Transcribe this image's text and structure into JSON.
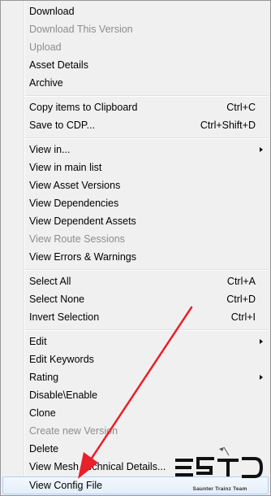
{
  "menu": {
    "items": [
      {
        "label": "Download",
        "shortcut": "",
        "submenu": false,
        "disabled": false
      },
      {
        "label": "Download This Version",
        "shortcut": "",
        "submenu": false,
        "disabled": true
      },
      {
        "label": "Upload",
        "shortcut": "",
        "submenu": false,
        "disabled": true
      },
      {
        "label": "Asset Details",
        "shortcut": "",
        "submenu": false,
        "disabled": false
      },
      {
        "label": "Archive",
        "shortcut": "",
        "submenu": false,
        "disabled": false
      },
      {
        "separator": true
      },
      {
        "label": "Copy items to Clipboard",
        "shortcut": "Ctrl+C",
        "submenu": false,
        "disabled": false
      },
      {
        "label": "Save to CDP...",
        "shortcut": "Ctrl+Shift+D",
        "submenu": false,
        "disabled": false
      },
      {
        "separator": true
      },
      {
        "label": "View in...",
        "shortcut": "",
        "submenu": true,
        "disabled": false
      },
      {
        "label": "View in main list",
        "shortcut": "",
        "submenu": false,
        "disabled": false
      },
      {
        "label": "View Asset Versions",
        "shortcut": "",
        "submenu": false,
        "disabled": false
      },
      {
        "label": "View Dependencies",
        "shortcut": "",
        "submenu": false,
        "disabled": false
      },
      {
        "label": "View Dependent Assets",
        "shortcut": "",
        "submenu": false,
        "disabled": false
      },
      {
        "label": "View Route Sessions",
        "shortcut": "",
        "submenu": false,
        "disabled": true
      },
      {
        "label": "View Errors & Warnings",
        "shortcut": "",
        "submenu": false,
        "disabled": false
      },
      {
        "separator": true
      },
      {
        "label": "Select All",
        "shortcut": "Ctrl+A",
        "submenu": false,
        "disabled": false
      },
      {
        "label": "Select None",
        "shortcut": "Ctrl+D",
        "submenu": false,
        "disabled": false
      },
      {
        "label": "Invert Selection",
        "shortcut": "Ctrl+I",
        "submenu": false,
        "disabled": false
      },
      {
        "separator": true
      },
      {
        "label": "Edit",
        "shortcut": "",
        "submenu": true,
        "disabled": false
      },
      {
        "label": "Edit Keywords",
        "shortcut": "",
        "submenu": false,
        "disabled": false
      },
      {
        "label": "Rating",
        "shortcut": "",
        "submenu": true,
        "disabled": false
      },
      {
        "label": "Disable\\Enable",
        "shortcut": "",
        "submenu": false,
        "disabled": false
      },
      {
        "label": "Clone",
        "shortcut": "",
        "submenu": false,
        "disabled": false
      },
      {
        "label": "Create new Version",
        "shortcut": "",
        "submenu": false,
        "disabled": true
      },
      {
        "label": "Delete",
        "shortcut": "",
        "submenu": false,
        "disabled": false
      },
      {
        "label": "View Mesh Technical Details...",
        "shortcut": "",
        "submenu": false,
        "disabled": false
      },
      {
        "label": "View Config File",
        "shortcut": "",
        "submenu": false,
        "disabled": false,
        "highlighted": true
      }
    ]
  },
  "annotation": {
    "color": "#e8202a"
  },
  "watermark": {
    "logo_text": "ESTD",
    "subtitle": "Saunter Trainz Team"
  }
}
